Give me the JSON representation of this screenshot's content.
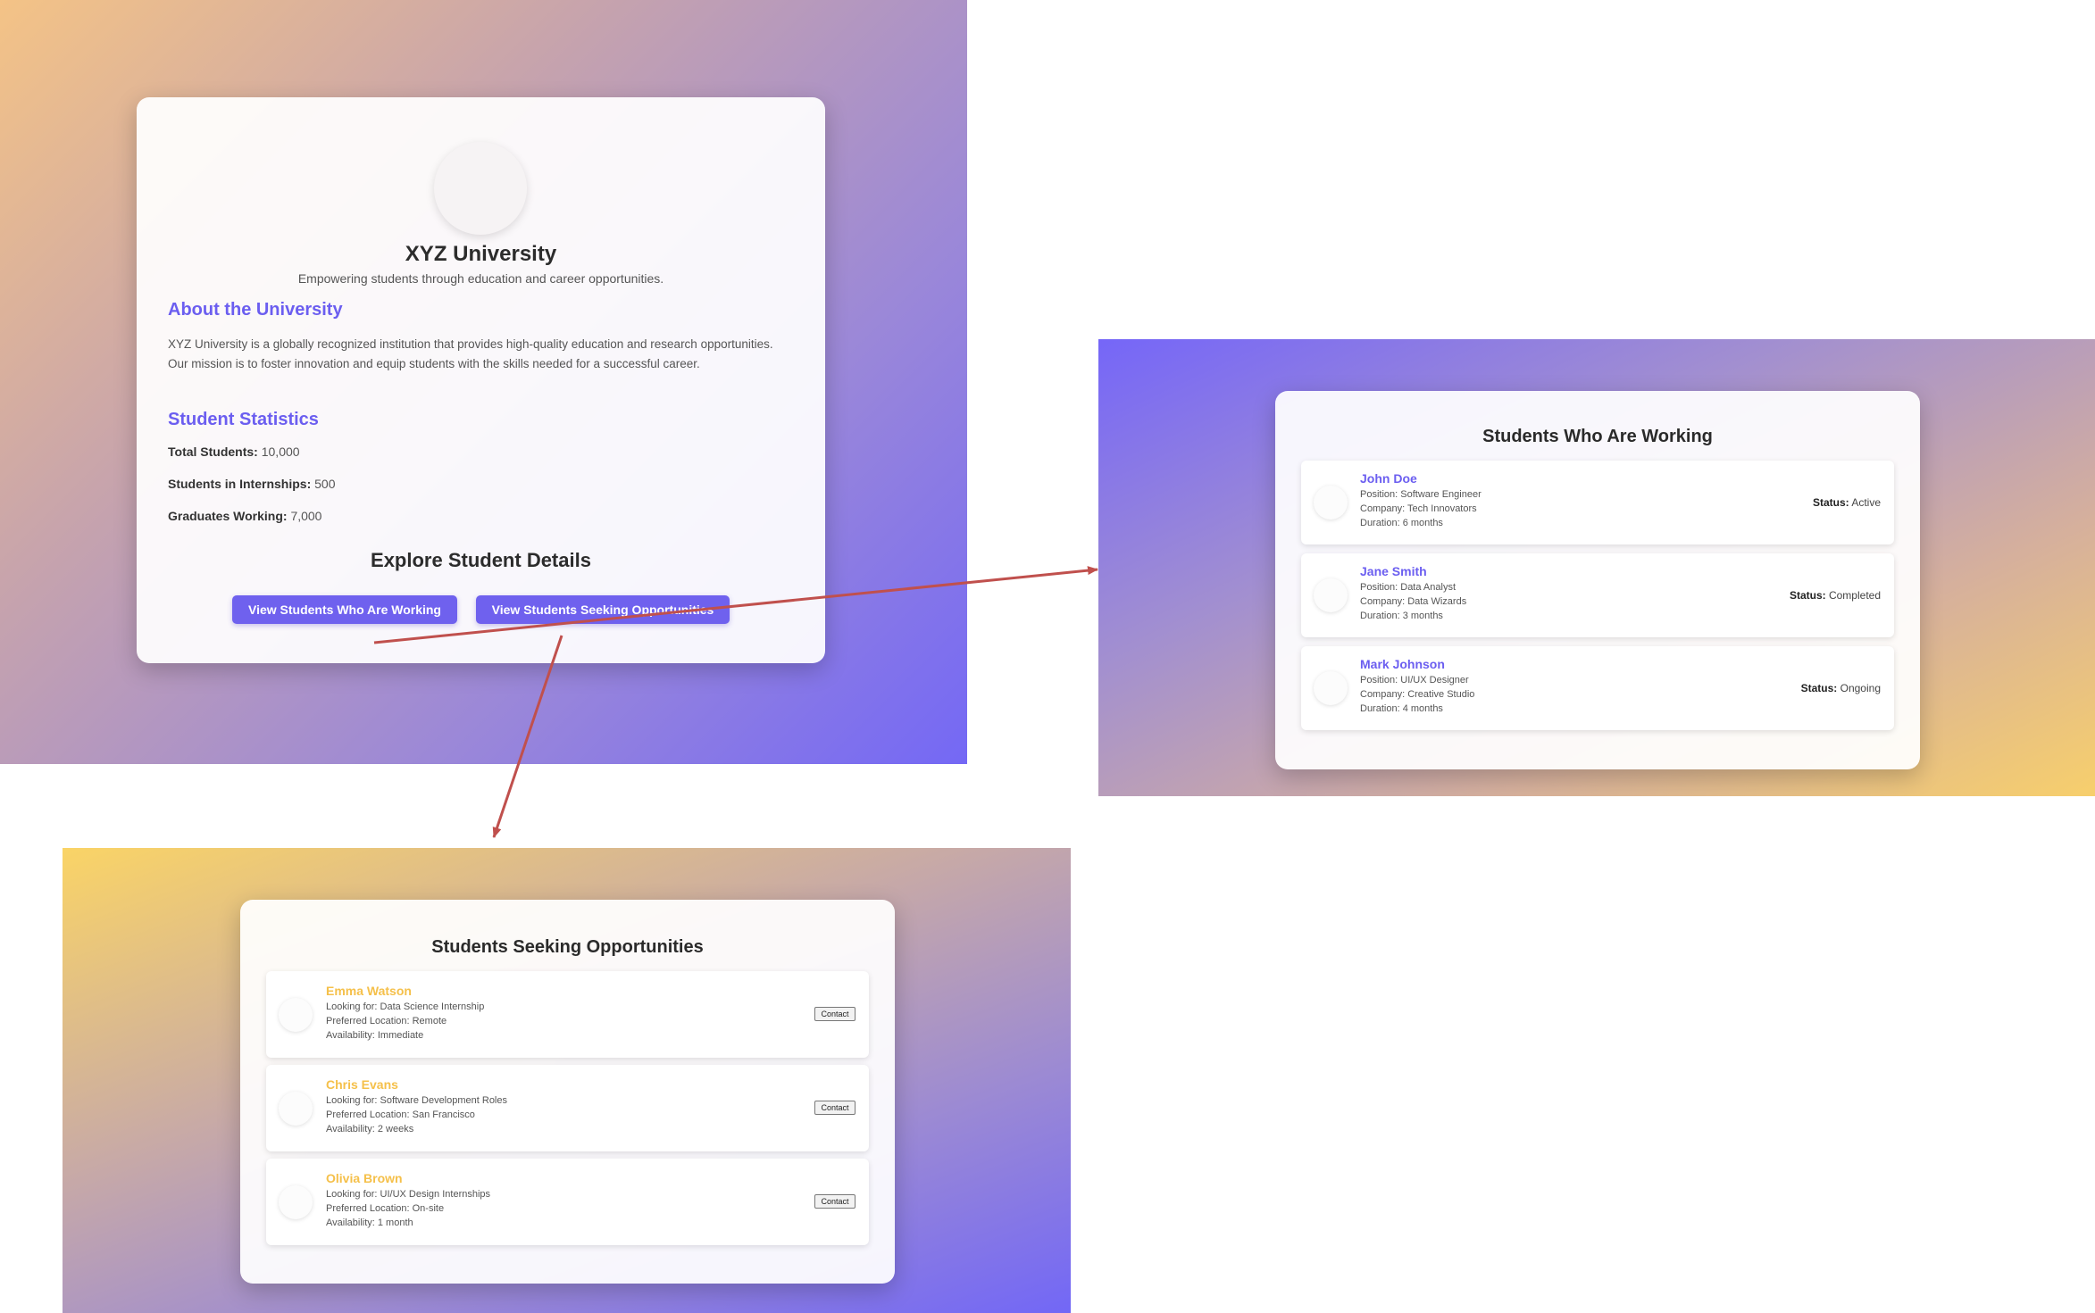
{
  "colors": {
    "accent": "#6b5ef0",
    "button": "#6f61ee",
    "seeking_name": "#f5c04a",
    "arrow": "#c0504d"
  },
  "main": {
    "logo_icon": "university-logo-placeholder",
    "title": "XYZ University",
    "tagline": "Empowering students through education and career opportunities.",
    "about_heading": "About the University",
    "about_text": "XYZ University is a globally recognized institution that provides high-quality education and research opportunities. Our mission is to foster innovation and equip students with the skills needed for a successful career.",
    "stats_heading": "Student Statistics",
    "stats": [
      {
        "label": "Total Students:",
        "value": "10,000"
      },
      {
        "label": "Students in Internships:",
        "value": "500"
      },
      {
        "label": "Graduates Working:",
        "value": "7,000"
      }
    ],
    "explore_heading": "Explore Student Details",
    "button_working": "View Students Who Are Working",
    "button_seeking": "View Students Seeking Opportunities"
  },
  "working": {
    "title": "Students Who Are Working",
    "status_label": "Status:",
    "students": [
      {
        "name": "John Doe",
        "position": "Position: Software Engineer",
        "company": "Company: Tech Innovators",
        "duration": "Duration: 6 months",
        "status": "Active"
      },
      {
        "name": "Jane Smith",
        "position": "Position: Data Analyst",
        "company": "Company: Data Wizards",
        "duration": "Duration: 3 months",
        "status": "Completed"
      },
      {
        "name": "Mark Johnson",
        "position": "Position: UI/UX Designer",
        "company": "Company: Creative Studio",
        "duration": "Duration: 4 months",
        "status": "Ongoing"
      }
    ]
  },
  "seeking": {
    "title": "Students Seeking Opportunities",
    "contact_label": "Contact",
    "students": [
      {
        "name": "Emma Watson",
        "looking": "Looking for: Data Science Internship",
        "location": "Preferred Location: Remote",
        "availability": "Availability: Immediate"
      },
      {
        "name": "Chris Evans",
        "looking": "Looking for: Software Development Roles",
        "location": "Preferred Location: San Francisco",
        "availability": "Availability: 2 weeks"
      },
      {
        "name": "Olivia Brown",
        "looking": "Looking for: UI/UX Design Internships",
        "location": "Preferred Location: On-site",
        "availability": "Availability: 1 month"
      }
    ]
  }
}
